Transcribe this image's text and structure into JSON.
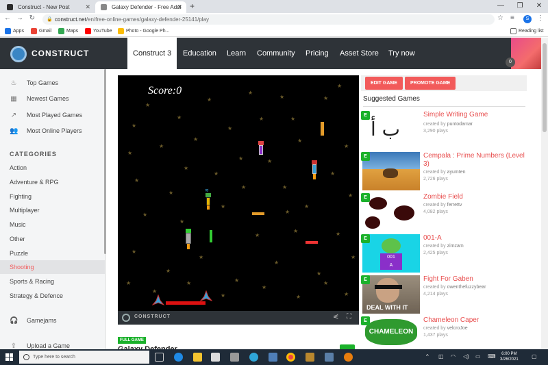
{
  "browser": {
    "tabs": [
      {
        "title": "Construct - New Post",
        "active": false
      },
      {
        "title": "Galaxy Defender - Free Addi",
        "active": true
      }
    ],
    "address": {
      "host": "construct.net",
      "path": "/en/free-online-games/galaxy-defender-25141/play"
    },
    "profile_initial": "S",
    "bookmarks": [
      {
        "label": "Apps",
        "icon": "apps-grid-icon",
        "color": "#1a73e8"
      },
      {
        "label": "Gmail",
        "icon": "gmail-icon",
        "color": "#ea4335"
      },
      {
        "label": "Maps",
        "icon": "maps-pin-icon",
        "color": "#34a853"
      },
      {
        "label": "YouTube",
        "icon": "youtube-icon",
        "color": "#ff0000"
      },
      {
        "label": "Photo - Google Ph...",
        "icon": "google-photos-icon",
        "color": "#fbbc05"
      }
    ],
    "reading_list": "Reading list"
  },
  "site": {
    "logo_text": "CONSTRUCT",
    "nav": [
      "Construct 3",
      "Education",
      "Learn",
      "Community",
      "Pricing",
      "Asset Store",
      "Try now"
    ],
    "notification_count": "0"
  },
  "sidebar": {
    "top_items": [
      {
        "label": "Top Games",
        "icon": "flame-icon"
      },
      {
        "label": "Newest Games",
        "icon": "calendar-icon"
      },
      {
        "label": "Most Played Games",
        "icon": "trending-icon"
      },
      {
        "label": "Most Online Players",
        "icon": "users-icon"
      }
    ],
    "categories_heading": "CATEGORIES",
    "categories": [
      "Action",
      "Adventure & RPG",
      "Fighting",
      "Multiplayer",
      "Music",
      "Other",
      "Puzzle",
      "Shooting",
      "Sports & Racing",
      "Strategy & Defence"
    ],
    "active_category": "Shooting",
    "extra_items": [
      {
        "label": "Gamejams",
        "icon": "headphones-icon"
      },
      {
        "label": "Upload a Game",
        "icon": "upload-icon"
      }
    ]
  },
  "game": {
    "score_text": "Score:0",
    "footer_brand": "CONSTRUCT",
    "full_game_badge": "FULL GAME",
    "title": "Galaxy Defender"
  },
  "panel": {
    "edit_button": "EDIT GAME",
    "promote_button": "PROMOTE GAME",
    "suggested_heading": "Suggested Games",
    "badge_letter": "E",
    "created_by_label": "created by",
    "plays_suffix": "plays",
    "games": [
      {
        "title": "Simple Writing Game",
        "author": "puntodamar",
        "plays": "3,290",
        "thumb": "arabic-letters"
      },
      {
        "title": "Cempala : Prime Numbers (Level 3)",
        "author": "ayumten",
        "plays": "2,726",
        "thumb": "desert-scene"
      },
      {
        "title": "Zombie Field",
        "author": "ferrettv",
        "plays": "4,082",
        "thumb": "cow-pattern"
      },
      {
        "title": "001-A",
        "author": "zimzam",
        "plays": "2,425",
        "thumb": "green-alien"
      },
      {
        "title": "Fight For Gaben",
        "author": "owenthefuzzybear",
        "plays": "4,214",
        "thumb": "deal-with-it"
      },
      {
        "title": "Chameleon Caper",
        "author": "velcroJoe",
        "plays": "1,437",
        "thumb": "chameleon-logo"
      }
    ]
  },
  "taskbar": {
    "search_placeholder": "Type here to search",
    "time": "6:00 PM",
    "date": "3/26/2021"
  },
  "colors": {
    "accent_red": "#f25a5a",
    "badge_green": "#1bb12b",
    "header_dark": "#2e3338"
  }
}
